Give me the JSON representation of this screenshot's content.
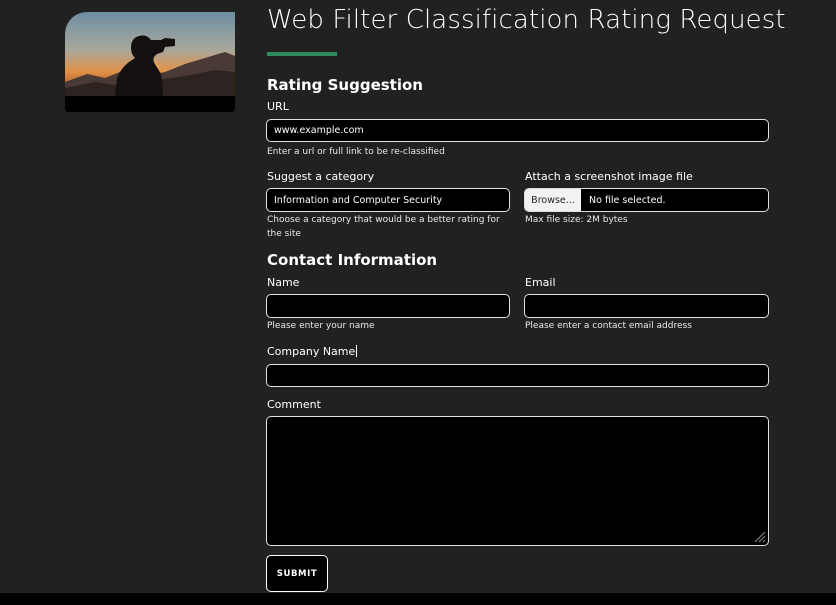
{
  "header": {
    "title": "Web Filter Classification Rating Request",
    "accent_color": "#2f8a5e"
  },
  "hero_image": {
    "icon": "person-with-binoculars-photo"
  },
  "rating_suggestion": {
    "heading": "Rating Suggestion",
    "url": {
      "label": "URL",
      "value": "www.example.com",
      "help": "Enter a url or full link to be re-classified"
    },
    "category": {
      "label": "Suggest a category",
      "value": "Information and Computer Security",
      "help": "Choose a category that would be a better rating for the site"
    },
    "screenshot": {
      "label": "Attach a screenshot image file",
      "browse_label": "Browse...",
      "status": "No file selected.",
      "help": "Max file size: 2M bytes"
    }
  },
  "contact_information": {
    "heading": "Contact Information",
    "name": {
      "label": "Name",
      "value": "",
      "help": "Please enter your name"
    },
    "email": {
      "label": "Email",
      "value": "",
      "help": "Please enter a contact email address"
    },
    "company": {
      "label": "Company Name",
      "value": ""
    },
    "comment": {
      "label": "Comment",
      "value": ""
    }
  },
  "actions": {
    "submit_label": "SUBMIT"
  },
  "colors": {
    "background": "#212121",
    "field_background": "#000000",
    "field_border": "#e0e0e0"
  }
}
